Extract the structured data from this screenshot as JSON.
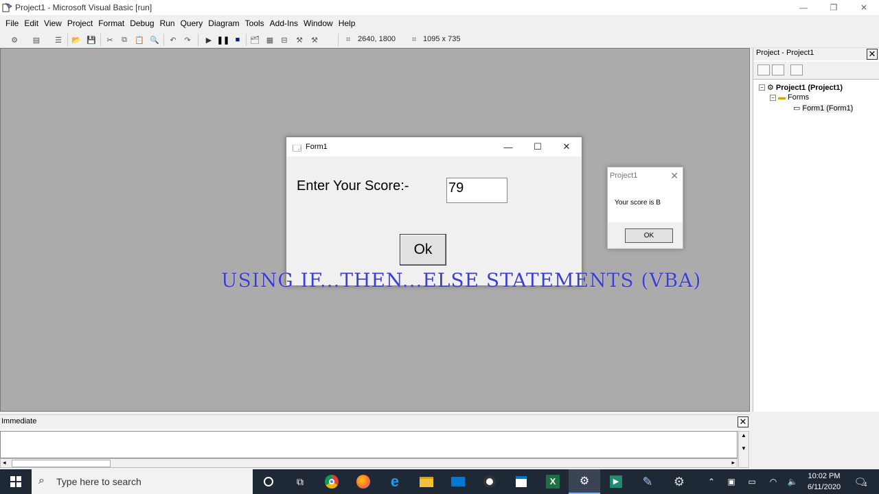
{
  "window": {
    "title": "Project1 - Microsoft Visual Basic [run]",
    "minimize_glyph": "—",
    "restore_glyph": "❐",
    "close_glyph": "✕"
  },
  "menu": [
    "File",
    "Edit",
    "View",
    "Project",
    "Format",
    "Debug",
    "Run",
    "Query",
    "Diagram",
    "Tools",
    "Add-Ins",
    "Window",
    "Help"
  ],
  "toolbar": {
    "position_text": "2640, 1800",
    "size_text": "1095 x 735"
  },
  "project_panel": {
    "title": "Project - Project1",
    "tree": {
      "root": "Project1 (Project1)",
      "folder": "Forms",
      "item": "Form1 (Form1)"
    }
  },
  "immediate": {
    "title": "Immediate"
  },
  "form1": {
    "title": "Form1",
    "label": "Enter Your Score:-",
    "input_value": "79",
    "button": "Ok"
  },
  "msgbox": {
    "title": "Project1",
    "message": "Your score is B",
    "button": "OK"
  },
  "caption": "USING IF...THEN...ELSE STATEMENTS (VBA)",
  "taskbar": {
    "search_placeholder": "Type here to search",
    "time": "10:02 PM",
    "date": "6/11/2020",
    "notifications": "4"
  },
  "colors": {
    "workspace": "#ababab",
    "taskbar": "#1f2936",
    "caption": "#3a3fd1"
  }
}
